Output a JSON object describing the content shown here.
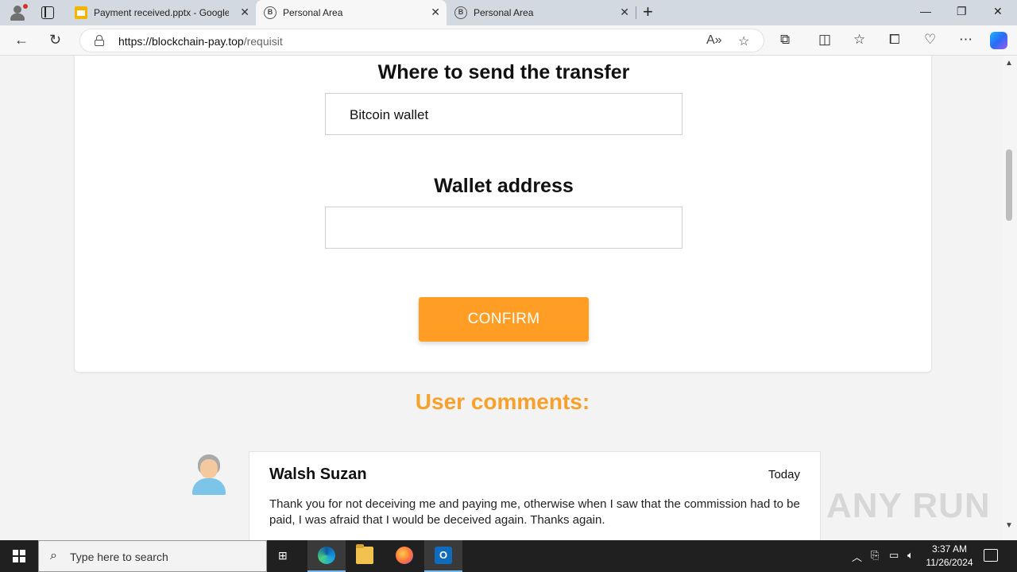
{
  "browser": {
    "tabs": [
      {
        "title": "Payment received.pptx - Google",
        "active": false,
        "favicon": "slides-icon"
      },
      {
        "title": "Personal Area",
        "active": true,
        "favicon": "b-site-icon"
      },
      {
        "title": "Personal Area",
        "active": false,
        "favicon": "b-site-icon"
      }
    ],
    "url_host": "https://blockchain-pay.top",
    "url_path": "/requisit"
  },
  "form": {
    "transfer_heading": "Where to send the transfer",
    "transfer_value": "Bitcoin wallet",
    "wallet_heading": "Wallet address",
    "wallet_value": "",
    "confirm_label": "CONFIRM"
  },
  "comments": {
    "title": "User comments:",
    "items": [
      {
        "name": "Walsh Suzan",
        "date": "Today",
        "text": "Thank you for not deceiving me and paying me, otherwise when I saw that the commission had to be paid, I was afraid that I would be deceived again. Thanks again."
      }
    ]
  },
  "watermark": "ANY RUN",
  "taskbar": {
    "search_placeholder": "Type here to search",
    "time": "3:37 AM",
    "date": "11/26/2024"
  },
  "colors": {
    "accent": "#ff9d24",
    "comments_title": "#f7a02b"
  }
}
